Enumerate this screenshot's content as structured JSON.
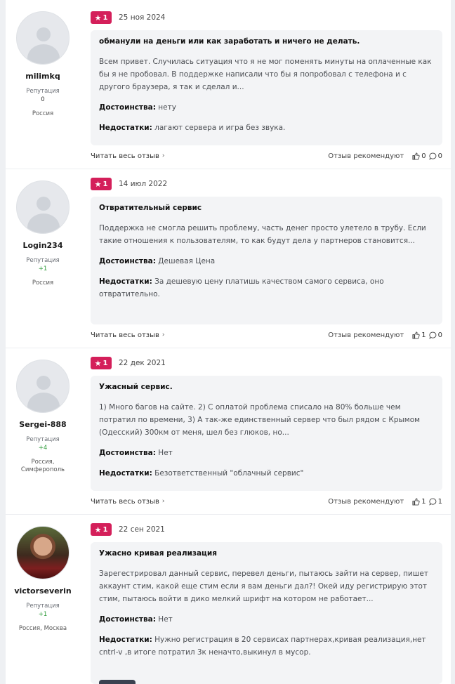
{
  "reviews": [
    {
      "user": "milimkq",
      "rep_label": "Репутация",
      "rep_value": "0",
      "location": "Россия",
      "rating": "1",
      "date": "25 ноя 2024",
      "title": "обманули на деньги или как заработать и ничего не делать.",
      "text": "Всем привет. Случилась ситуация что я не мог поменять минуты на оплаченные как бы я не пробовал. В поддержке написали что бы я попробовал с телефона и с другого браузера, я так и сделал и...",
      "pros_label": "Достоинства:",
      "pros": "нету",
      "cons_label": "Недостатки:",
      "cons": "лагают сервера и игра без звука.",
      "read_all": "Читать весь отзыв",
      "recommend": "Отзыв рекомендуют",
      "likes": "0",
      "comments": "0"
    },
    {
      "user": "Login234",
      "rep_label": "Репутация",
      "rep_value": "+1",
      "location": "Россия",
      "rating": "1",
      "date": "14 июл 2022",
      "title": "Отвратительный сервис",
      "text": "Поддержка не смогла решить проблему, часть денег просто улетело в трубу. Если такие отношения к пользователям, то как будут дела у партнеров становится...",
      "pros_label": "Достоинства:",
      "pros": "Дешевая Цена",
      "cons_label": "Недостатки:",
      "cons": "За дешевую цену платишь качеством самого сервиса, оно отвратительно.",
      "read_all": "Читать весь отзыв",
      "recommend": "Отзыв рекомендуют",
      "likes": "1",
      "comments": "0"
    },
    {
      "user": "Sergei-888",
      "rep_label": "Репутация",
      "rep_value": "+4",
      "location": "Россия,\nСимферополь",
      "rating": "1",
      "date": "22 дек 2021",
      "title": "Ужасный сервис.",
      "text": "1) Много багов на сайте. 2) С оплатой проблема списало на 80% больше чем потратил по времени, 3) А так-же единственный сервер что был рядом с Крымом (Одесский) 300км от меня, шел без глюков, но...",
      "pros_label": "Достоинства:",
      "pros": "Нет",
      "cons_label": "Недостатки:",
      "cons": "Безответственный \"облачный сервис\"",
      "read_all": "Читать весь отзыв",
      "recommend": "Отзыв рекомендуют",
      "likes": "1",
      "comments": "1"
    },
    {
      "user": "victorseverin",
      "rep_label": "Репутация",
      "rep_value": "+1",
      "location": "Россия, Москва",
      "rating": "1",
      "date": "22 сен 2021",
      "title": "Ужасно кривая реализация",
      "text": "Зарегестрировал данный сервис, перевел деньги, пытаюсь зайти на сервер, пишет аккаунт стим, какой еще стим если я вам деньги дал?! Окей иду регистрирую этот стим, пытаюсь войти в дико мелкий шрифт на котором не работает...",
      "pros_label": "Достоинства:",
      "pros": "Нет",
      "cons_label": "Недостатки:",
      "cons": "Нужно регистрация в 20 сервисах партнерах,кривая реализация,нет cntrl-v ,в итоге потратил 3к неначто,выкинул в мусор."
    }
  ],
  "colors": {
    "badge": "#d41f5a",
    "card_bg": "#f3f4f6",
    "positive_rep": "#2e9b3a"
  },
  "icons": {
    "star": "star-icon",
    "chevron": "chevron-right-icon",
    "like": "thumb-up-icon",
    "comment": "comment-icon"
  }
}
